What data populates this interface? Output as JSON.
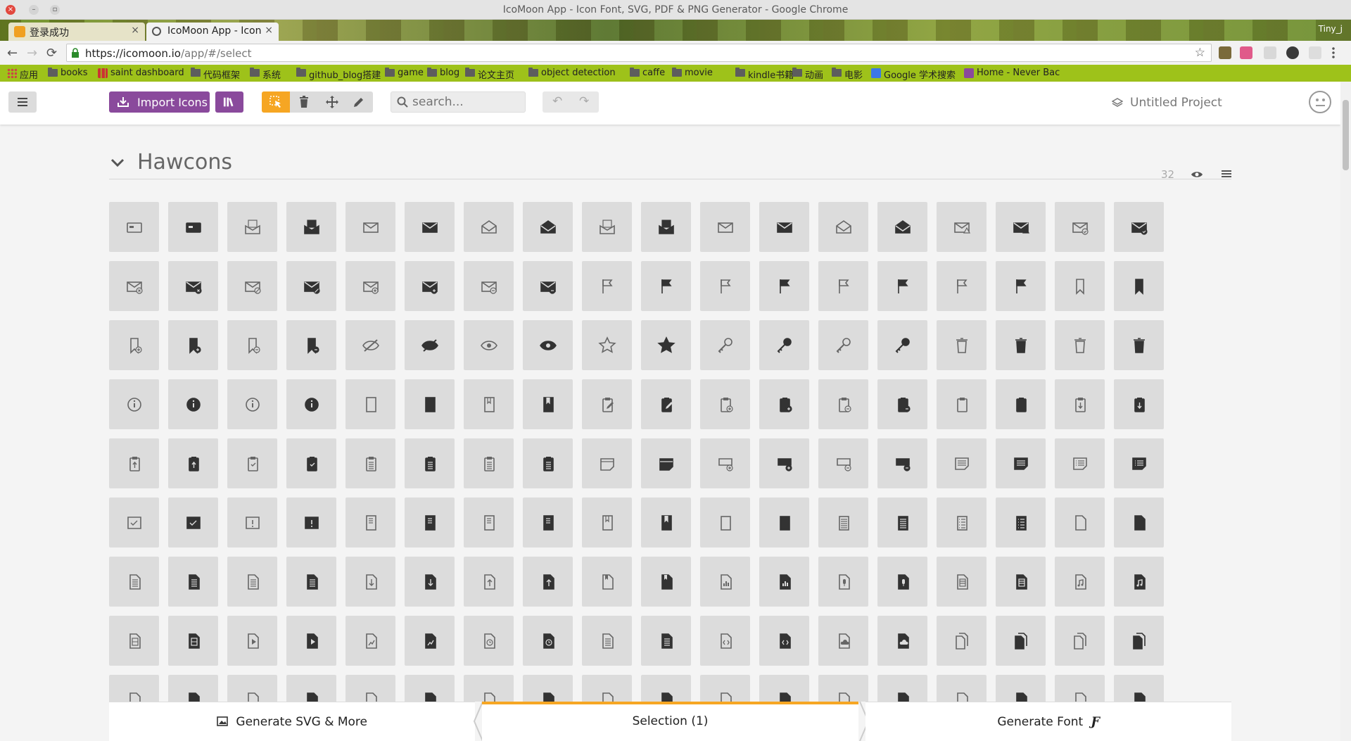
{
  "window": {
    "title": "IcoMoon App - Icon Font, SVG, PDF & PNG Generator - Google Chrome"
  },
  "tabs": [
    {
      "label": "登录成功",
      "active": false
    },
    {
      "label": "IcoMoon App - Icon",
      "active": true
    }
  ],
  "profile_name": "Tiny_j",
  "address": {
    "host": "https://icomoon.io",
    "path": "/app/#/select"
  },
  "bookmarks": [
    {
      "label": "应用",
      "icon": "apps-icon"
    },
    {
      "label": "books",
      "icon": "folder-icon"
    },
    {
      "label": "saint dashboard",
      "icon": "chart-icon"
    },
    {
      "label": "代码框架",
      "icon": "folder-icon"
    },
    {
      "label": "系统",
      "icon": "folder-icon"
    },
    {
      "label": "github_blog搭建",
      "icon": "folder-icon"
    },
    {
      "label": "game",
      "icon": "folder-icon"
    },
    {
      "label": "blog",
      "icon": "folder-icon"
    },
    {
      "label": "论文主页",
      "icon": "folder-icon"
    },
    {
      "label": "object detection",
      "icon": "folder-icon"
    },
    {
      "label": "caffe",
      "icon": "folder-icon"
    },
    {
      "label": "movie",
      "icon": "folder-icon"
    },
    {
      "label": "kindle书籍",
      "icon": "folder-icon"
    },
    {
      "label": "动画",
      "icon": "folder-icon"
    },
    {
      "label": "电影",
      "icon": "folder-icon"
    },
    {
      "label": "Google 学术搜索",
      "icon": "google-icon"
    },
    {
      "label": "Home - Never Bac",
      "icon": "page-icon"
    }
  ],
  "toolbar": {
    "import_label": "Import Icons",
    "search_placeholder": "search...",
    "project_label": "Untitled Project"
  },
  "icon_set": {
    "name": "Hawcons",
    "count": "32"
  },
  "icons": [
    "card",
    "card",
    "envelope-open-doc",
    "envelope-open-doc",
    "envelope",
    "envelope",
    "envelope-open",
    "envelope-open",
    "envelope-open-doc",
    "envelope-open-doc",
    "envelope",
    "envelope",
    "envelope-open",
    "envelope-open",
    "envelope-warning",
    "envelope-warning",
    "envelope-check",
    "envelope-check",
    "envelope-x",
    "envelope-x",
    "envelope-block",
    "envelope-block",
    "envelope-plus",
    "envelope-plus",
    "envelope-minus",
    "envelope-minus",
    "flag",
    "flag",
    "flag",
    "flag",
    "flag",
    "flag",
    "flag",
    "flag",
    "bookmark",
    "bookmark",
    "bookmark-plus",
    "bookmark-plus",
    "bookmark-minus",
    "bookmark-minus",
    "eye-off",
    "eye-off",
    "eye",
    "eye",
    "star",
    "star",
    "key",
    "key",
    "key",
    "key",
    "trash",
    "trash",
    "trash",
    "trash",
    "info",
    "info",
    "info",
    "info",
    "book",
    "book",
    "book-mark",
    "book-mark",
    "clipboard-edit",
    "clipboard-edit",
    "clipboard-plus",
    "clipboard-plus",
    "clipboard-minus",
    "clipboard-minus",
    "clipboard",
    "clipboard",
    "clipboard-down",
    "clipboard-down",
    "clipboard-up",
    "clipboard-up",
    "clipboard-check",
    "clipboard-check",
    "clipboard-list",
    "clipboard-list",
    "clipboard-list",
    "clipboard-list",
    "note",
    "note",
    "note-plus",
    "note-plus",
    "note-minus",
    "note-minus",
    "note-text",
    "note-text",
    "note-list",
    "note-list",
    "note-check",
    "note-check",
    "note-warning",
    "note-warning",
    "notebook",
    "notebook",
    "notebook",
    "notebook",
    "book-mark",
    "book-mark",
    "notepad",
    "notepad",
    "notepad-text",
    "notepad-text",
    "notepad-list",
    "notepad-list",
    "document",
    "document",
    "document-text",
    "document-text",
    "document-text",
    "document-text",
    "document-down",
    "document-down",
    "document-up",
    "document-up",
    "document-bookmark",
    "document-bookmark",
    "document-chart",
    "document-chart",
    "document-mic",
    "document-mic",
    "document-table",
    "document-table",
    "document-music",
    "document-music",
    "document-film",
    "document-film",
    "document-play",
    "document-play",
    "document-graph",
    "document-graph",
    "document-clock",
    "document-clock",
    "document-lines",
    "document-lines",
    "document-code",
    "document-code",
    "document-cloud",
    "document-cloud",
    "documents",
    "documents",
    "documents",
    "documents",
    "document",
    "document",
    "document",
    "document",
    "document",
    "document",
    "document",
    "document",
    "document",
    "document",
    "document",
    "document",
    "document",
    "document",
    "document",
    "document",
    "document",
    "document"
  ],
  "bottom": {
    "generate_svg_label": "Generate SVG & More",
    "selection_label": "Selection (1)",
    "generate_font_label": "Generate Font"
  },
  "colors": {
    "accent_purple": "#8a4a9c",
    "accent_orange": "#f6a623",
    "bookmark_bar": "#9ec21a"
  }
}
